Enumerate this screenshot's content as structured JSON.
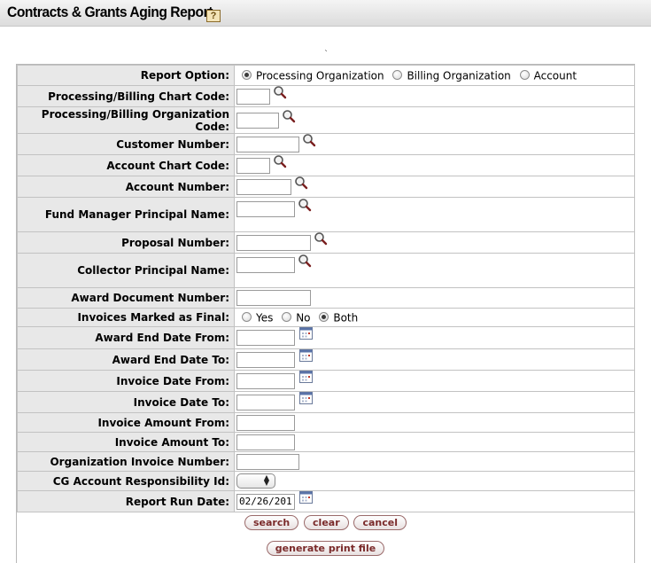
{
  "header": {
    "title": "Contracts & Grants Aging Report",
    "help_icon_glyph": "?"
  },
  "form": {
    "report_option": {
      "label": "Report Option:",
      "options": [
        "Processing Organization",
        "Billing Organization",
        "Account"
      ],
      "selected": "Processing Organization"
    },
    "chart_code_label": "Processing/Billing Chart Code:",
    "org_code_label_line1": "Processing/Billing Organization",
    "org_code_label_line2": "Code:",
    "customer_number_label": "Customer Number:",
    "account_chart_code_label": "Account Chart Code:",
    "account_number_label": "Account Number:",
    "fund_manager_label": "Fund Manager Principal Name:",
    "proposal_number_label": "Proposal Number:",
    "collector_label": "Collector Principal Name:",
    "award_doc_number_label": "Award Document Number:",
    "invoices_final": {
      "label": "Invoices Marked as Final:",
      "options": [
        "Yes",
        "No",
        "Both"
      ],
      "selected": "Both"
    },
    "award_end_from_label": "Award End Date From:",
    "award_end_to_label": "Award End Date To:",
    "invoice_date_from_label": "Invoice Date From:",
    "invoice_date_to_label": "Invoice Date To:",
    "invoice_amount_from_label": "Invoice Amount From:",
    "invoice_amount_to_label": "Invoice Amount To:",
    "org_invoice_number_label": "Organization Invoice Number:",
    "cg_account_resp_label": "CG Account Responsibility Id:",
    "cg_account_resp_value": "",
    "report_run_date_label": "Report Run Date:",
    "report_run_date_value": "02/26/201"
  },
  "buttons": {
    "search": "search",
    "clear": "clear",
    "cancel": "cancel",
    "generate": "generate print file"
  },
  "icons": {
    "lookup": "magnifier-lookup-icon",
    "calendar": "calendar-icon",
    "help": "help-icon"
  },
  "colors": {
    "label_bg": "#e8e8e8",
    "button_text": "#7a2a2a",
    "help_bg": "#f3e3b7"
  }
}
